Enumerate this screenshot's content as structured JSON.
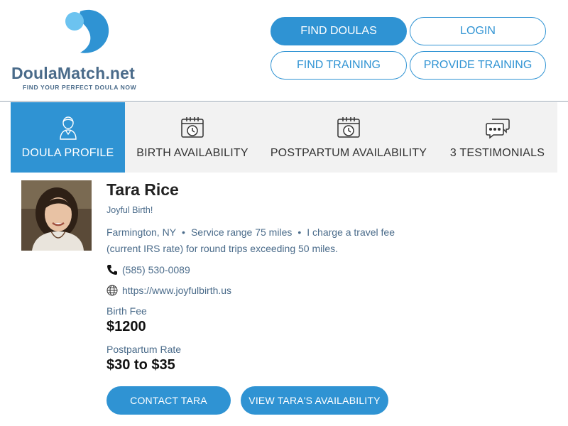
{
  "brand": {
    "name_part1": "Doula",
    "name_part2": "Match",
    "name_part3": ".net",
    "tagline": "FIND YOUR PERFECT DOULA NOW",
    "primary_color": "#2f93d3",
    "text_color": "#4a6b8a"
  },
  "nav": {
    "find_doulas": "FIND DOULAS",
    "login": "LOGIN",
    "find_training": "FIND TRAINING",
    "provide_training": "PROVIDE TRAINING"
  },
  "tabs": [
    {
      "label": "DOULA PROFILE",
      "icon": "person-icon",
      "active": true
    },
    {
      "label": "BIRTH AVAILABILITY",
      "icon": "calendar-clock-icon",
      "active": false
    },
    {
      "label": "POSTPARTUM AVAILABILITY",
      "icon": "calendar-clock-icon",
      "active": false
    },
    {
      "label": "3 TESTIMONIALS",
      "icon": "chat-bubbles-icon",
      "active": false
    }
  ],
  "profile": {
    "name": "Tara Rice",
    "business": "Joyful Birth!",
    "location": "Farmington, NY",
    "service_range": "Service range 75 miles",
    "travel_fee": "I charge a travel fee (current IRS rate) for round trips exceeding 50 miles.",
    "phone": "(585) 530-0089",
    "website": "https://www.joyfulbirth.us",
    "birth_fee_label": "Birth Fee",
    "birth_fee": "$1200",
    "postpartum_rate_label": "Postpartum Rate",
    "postpartum_rate": "$30 to $35"
  },
  "actions": {
    "contact": "CONTACT TARA",
    "availability": "VIEW TARA'S AVAILABILITY"
  }
}
